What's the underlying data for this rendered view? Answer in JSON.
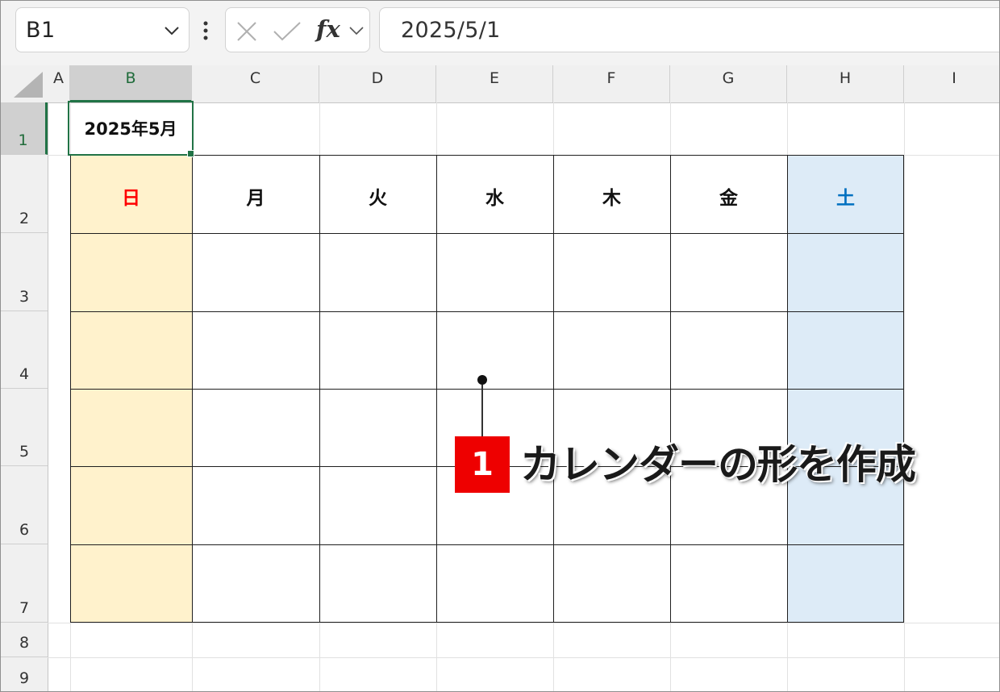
{
  "formula_bar": {
    "name_box": "B1",
    "formula": "2025/5/1",
    "fx_label": "fx"
  },
  "columns": [
    {
      "id": "A",
      "label": "A"
    },
    {
      "id": "B",
      "label": "B"
    },
    {
      "id": "C",
      "label": "C"
    },
    {
      "id": "D",
      "label": "D"
    },
    {
      "id": "E",
      "label": "E"
    },
    {
      "id": "F",
      "label": "F"
    },
    {
      "id": "G",
      "label": "G"
    },
    {
      "id": "H",
      "label": "H"
    },
    {
      "id": "I",
      "label": "I"
    }
  ],
  "rows": [
    "1",
    "2",
    "3",
    "4",
    "5",
    "6",
    "7",
    "8",
    "9"
  ],
  "selected_column": "B",
  "selected_row": "1",
  "cells": {
    "b1": "2025年5月"
  },
  "weekdays": [
    "日",
    "月",
    "火",
    "水",
    "木",
    "金",
    "土"
  ],
  "colors": {
    "sunday_text": "#ff0000",
    "saturday_text": "#0070c0",
    "sunday_fill": "#fff2cc",
    "saturday_fill": "#ddebf7",
    "accent_green": "#217346",
    "badge_red": "#ee0000"
  },
  "annotation": {
    "number": "1",
    "text": "カレンダーの形を作成"
  }
}
